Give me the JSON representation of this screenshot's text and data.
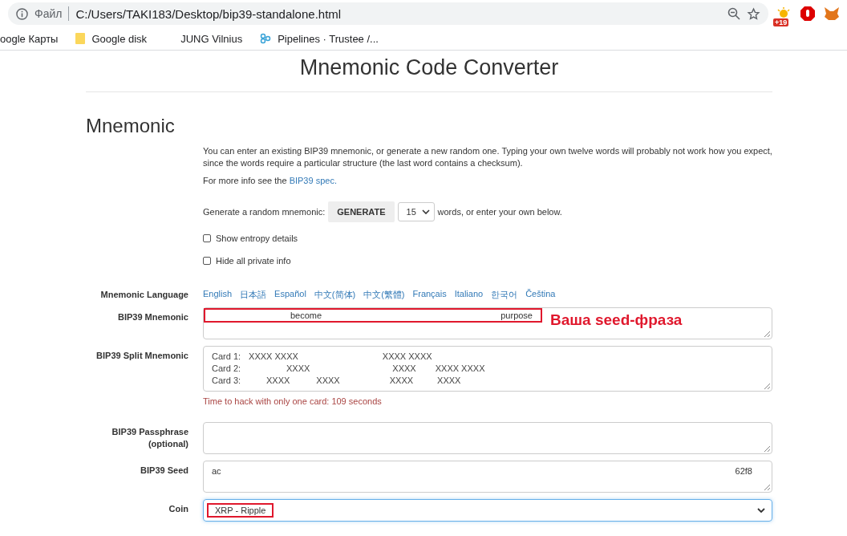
{
  "browser": {
    "site_label": "Файл",
    "url": "C:/Users/TAKI183/Desktop/bip39-standalone.html",
    "extension_badge": "+19"
  },
  "bookmarks": [
    {
      "label": "oogle Карты",
      "kind": "plain"
    },
    {
      "label": "Google disk",
      "kind": "folder"
    },
    {
      "label": "JUNG Vilnius",
      "kind": "blank"
    },
    {
      "label": "Pipelines · Trustee /...",
      "kind": "app"
    }
  ],
  "page": {
    "title": "Mnemonic Code Converter",
    "section": "Mnemonic",
    "intro": "You can enter an existing BIP39 mnemonic, or generate a new random one. Typing your own twelve words will probably not work how you expect, since the words require a particular structure (the last word contains a checksum).",
    "more_info": "For more info see the",
    "spec_link": "BIP39 spec.",
    "generate_label": "Generate a random mnemonic:",
    "generate_button": "GENERATE",
    "word_count": "15",
    "generate_suffix": "words, or enter your own below.",
    "options": [
      {
        "label": "Show entropy details",
        "checked": false
      },
      {
        "label": "Hide all private info",
        "checked": false
      }
    ],
    "language_label": "Mnemonic Language",
    "languages": [
      "English",
      "日本語",
      "Español",
      "中文(简体)",
      "中文(繁體)",
      "Français",
      "Italiano",
      "한국어",
      "Čeština"
    ],
    "mnemonic": {
      "label": "BIP39 Mnemonic",
      "words": [
        "become",
        "purpose"
      ],
      "annotation": "Ваша seed-фраза"
    },
    "split": {
      "label": "BIP39 Split Mnemonic",
      "cards": [
        {
          "label": "Card 1:",
          "tokens": [
            "XXXX XXXX",
            "XXXX XXXX"
          ]
        },
        {
          "label": "Card 2:",
          "tokens": [
            "XXXX",
            "XXXX",
            "XXXX XXXX"
          ]
        },
        {
          "label": "Card 3:",
          "tokens": [
            "XXXX",
            "XXXX",
            "XXXX",
            "XXXX"
          ]
        }
      ],
      "warning": "Time to hack with only one card: 109 seconds"
    },
    "passphrase": {
      "label": "BIP39 Passphrase (optional)"
    },
    "seed": {
      "label": "BIP39 Seed",
      "parts": [
        "ac",
        "62f8"
      ]
    },
    "coin": {
      "label": "Coin",
      "value": "XRP - Ripple"
    }
  }
}
